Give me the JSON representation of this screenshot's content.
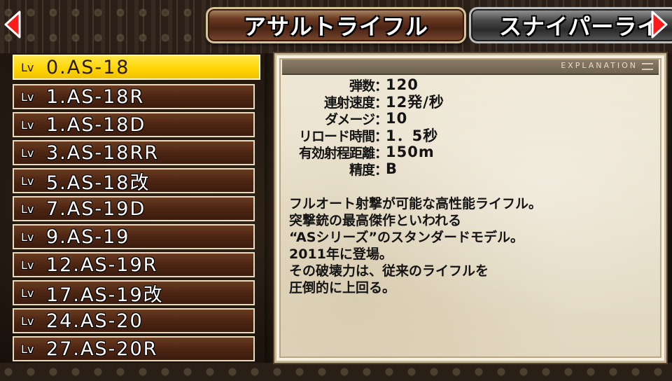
{
  "tabs": [
    {
      "label": "アサルトライフル",
      "active": true
    },
    {
      "label": "スナイパーライ",
      "active": false
    }
  ],
  "panel": {
    "header_label": "EXPLANATION",
    "stats": [
      {
        "label": "弾数",
        "value": "120"
      },
      {
        "label": "連射速度",
        "value": "12発/秒"
      },
      {
        "label": "ダメージ",
        "value": "10"
      },
      {
        "label": "リロード時間",
        "value": "1．5秒"
      },
      {
        "label": "有効射程距離",
        "value": "150m"
      },
      {
        "label": "精度",
        "value": "B"
      }
    ],
    "separator": "：",
    "description": [
      "フルオート射撃が可能な高性能ライフル。",
      "突撃銃の最高傑作といわれる",
      "“ASシリーズ”のスタンダードモデル。",
      "2011年に登場。",
      "その破壊力は、従来のライフルを",
      "圧倒的に上回る。"
    ]
  },
  "weapons": [
    {
      "lv": "Lv",
      "name": " 0.AS-18",
      "selected": true
    },
    {
      "lv": "Lv",
      "name": " 1.AS-18R",
      "selected": false
    },
    {
      "lv": "Lv",
      "name": " 1.AS-18D",
      "selected": false
    },
    {
      "lv": "Lv",
      "name": " 3.AS-18RR",
      "selected": false
    },
    {
      "lv": "Lv",
      "name": " 5.AS-18改",
      "selected": false
    },
    {
      "lv": "Lv",
      "name": " 7.AS-19D",
      "selected": false
    },
    {
      "lv": "Lv",
      "name": " 9.AS-19",
      "selected": false
    },
    {
      "lv": "Lv",
      "name": "12.AS-19R",
      "selected": false
    },
    {
      "lv": "Lv",
      "name": "17.AS-19改",
      "selected": false
    },
    {
      "lv": "Lv",
      "name": "24.AS-20",
      "selected": false
    },
    {
      "lv": "Lv",
      "name": "27.AS-20R",
      "selected": false
    }
  ],
  "icons": {
    "left": "arrow-left-icon",
    "right": "arrow-right-icon"
  },
  "colors": {
    "selected": "#ffd400",
    "arrow": "#ff1a1a",
    "list_item": "#4a2412",
    "panel": "#e8e0cc"
  }
}
